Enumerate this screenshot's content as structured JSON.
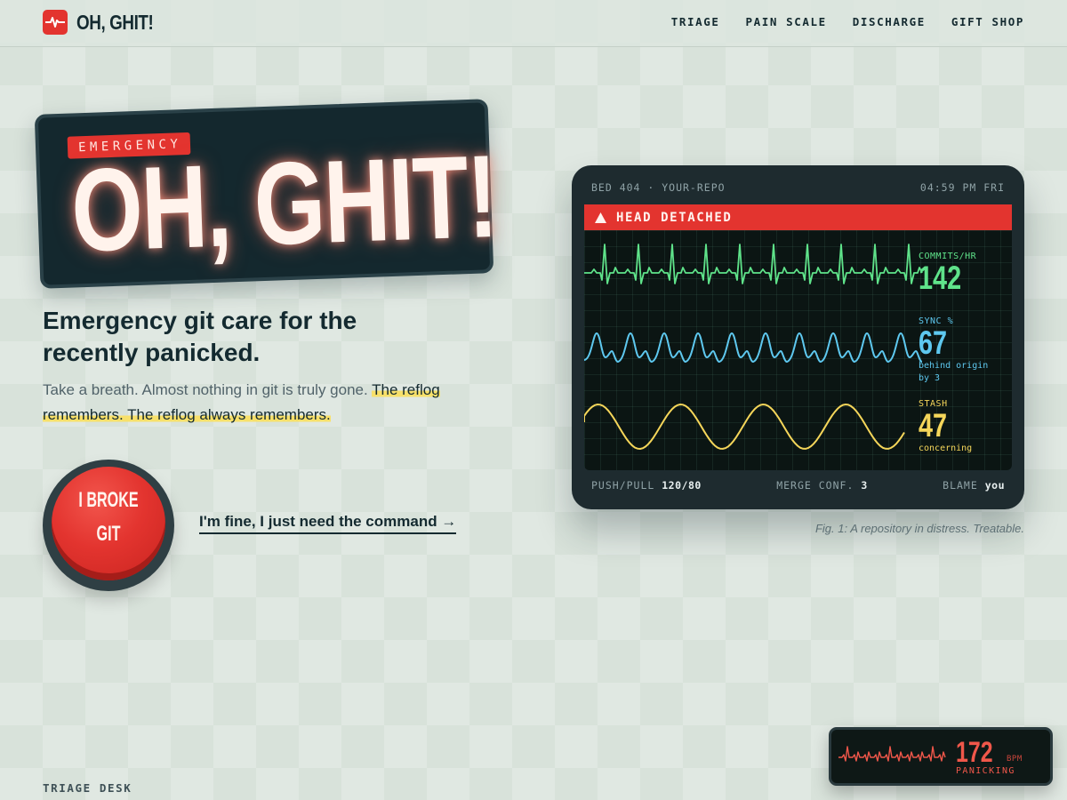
{
  "nav": {
    "brand": "OH, GHIT!",
    "links": [
      "TRIAGE",
      "PAIN SCALE",
      "DISCHARGE",
      "GIFT SHOP"
    ]
  },
  "hero": {
    "tag": "EMERGENCY",
    "title": "OH, GHIT!",
    "headline": "Emergency git care for the recently panicked.",
    "subtext_plain": "Take a breath. Almost nothing in git is truly gone. ",
    "subtext_highlight": "The reflog remembers. The reflog always remembers.",
    "panic_button": [
      "I BROKE",
      "GIT"
    ],
    "fine_link": "I'm fine, I just need the command →"
  },
  "monitor": {
    "bed": "BED 404 · YOUR-REPO",
    "time": "04:59 PM FRI",
    "alert": "HEAD DETACHED",
    "vitals": [
      {
        "label": "COMMITS/HR",
        "value": "142",
        "sub": "",
        "color": "#5fe38a"
      },
      {
        "label": "SYNC %",
        "value": "67",
        "sub": "behind origin by 3",
        "color": "#5ec8ef"
      },
      {
        "label": "STASH",
        "value": "47",
        "sub": "concerning",
        "color": "#f5d65a"
      }
    ],
    "footer": {
      "push_pull_label": "PUSH/PULL",
      "push_pull_value": "120/80",
      "merge_label": "MERGE CONF.",
      "merge_value": "3",
      "blame_label": "BLAME",
      "blame_value": "you"
    },
    "caption": "Fig. 1: A repository in distress. Treatable."
  },
  "section_label": "TRIAGE DESK",
  "mini_monitor": {
    "value": "172",
    "unit": "BPM",
    "state": "PANICKING"
  },
  "colors": {
    "accent": "#e3342f",
    "ink": "#142a30",
    "highlight": "#f7e06b"
  }
}
